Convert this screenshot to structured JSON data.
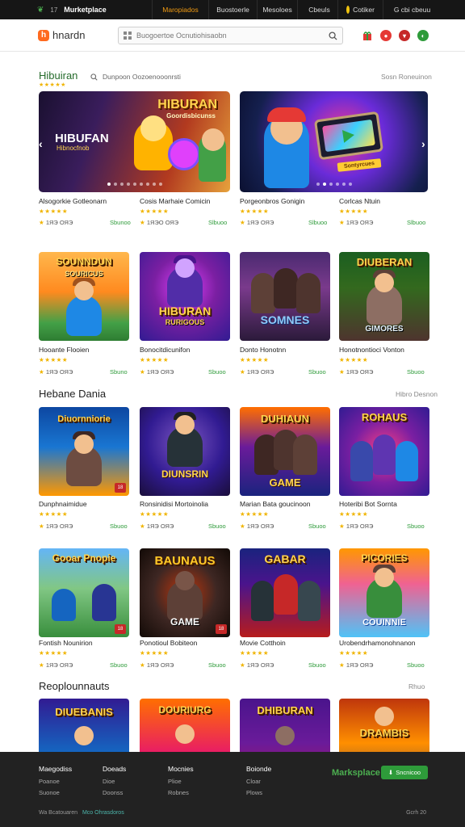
{
  "topbar": {
    "number": "17",
    "brand": "Murketplace",
    "items": [
      {
        "label": "Maropiados",
        "active": true
      },
      {
        "label": "Buostoerle",
        "active": false
      },
      {
        "label": "Mesoloes",
        "active": false
      },
      {
        "label": "Cbeuls",
        "active": false,
        "icon": "coin-icon"
      },
      {
        "label": "Cotiker",
        "active": false,
        "icon": "coin-icon"
      },
      {
        "label": "G cbi cbeuu",
        "active": false,
        "icon": "gift-icon"
      }
    ]
  },
  "header": {
    "logo_letter": "h",
    "logo_text": "hnardn",
    "search_placeholder": "Buogoertoe Ocnutiohisaobn"
  },
  "section1": {
    "title": "Hibuiran",
    "stars": "★★★★★",
    "filter_text": "Dunpoon   Oozoenooonrsti",
    "link": "Sosn Roneuinon"
  },
  "banners": [
    {
      "title": "HIBUFAN",
      "subtitle": "Hibnocfnob",
      "logo": "HIBURAN",
      "logo_sub": "Goordisbicunss"
    },
    {
      "tag": "Sontyrcues"
    }
  ],
  "banner_captions": [
    {
      "name": "Alsogorkie Gotleonarn",
      "rating": "★★★★★",
      "meta": "1ЯЭ  ОЯЭ",
      "price": "Sbunoo"
    },
    {
      "name": "Cosis Marhaie Comicin",
      "rating": "★★★★★",
      "meta": "1ЯЭО ОЯЭ",
      "price": "Slbuoo"
    },
    {
      "name": "Porgeonbros Gonigin",
      "rating": "★★★★★",
      "meta": "1ЯЭ  ОЯЭ",
      "price": "Slbuoo"
    },
    {
      "name": "Corlcas Ntuin",
      "rating": "★★★★★",
      "meta": "1ЯЭ  ОЯЭ",
      "price": "Slbuoo"
    }
  ],
  "row1": [
    {
      "logo": "SOUNNDUN",
      "sub": "SOURICUS",
      "name": "Hooante Flooien",
      "rating": "★★★★★",
      "meta": "1ЯЭ  ОЯЭ",
      "price": "Sbuno"
    },
    {
      "logo": "HIBURAN",
      "sub": "RURIGOUS",
      "name": "Bonocitdicunifon",
      "rating": "★★★★★",
      "meta": "1ЯЭ  ОЯЭ",
      "price": "Sbuoo"
    },
    {
      "logo": "",
      "sub": "SOMNES",
      "name": "Donto Honotnn",
      "rating": "★★★★★",
      "meta": "1ЯЭ  ОЯЭ",
      "price": "Sbuoo"
    },
    {
      "logo": "DIUBERAN",
      "sub": "GIMORES",
      "name": "Honotnontioci Vonton",
      "rating": "★★★★★",
      "meta": "1ЯЭ  ОЯЭ",
      "price": "Sbuoo"
    }
  ],
  "section2": {
    "title": "Hebane Dania",
    "link": "Hibro Desnon"
  },
  "row2": [
    {
      "logo": "Diuornniorie",
      "sub": "",
      "name": "Dunphnaimidue",
      "rating": "★★★★★",
      "meta": "1ЯЭ  ОЯЭ",
      "price": "Sbuoo"
    },
    {
      "logo": "",
      "sub": "DIUNSRIN",
      "name": "Ronsinidisi Mortoinolia",
      "rating": "★★★★★",
      "meta": "1ЯЭ  ОЯЭ",
      "price": "Sbuoo"
    },
    {
      "logo": "DUHIAUN",
      "sub": "GAME",
      "name": "Marian Bata goucinoon",
      "rating": "★★★★★",
      "meta": "1ЯЭ  ОЯЭ",
      "price": "Sbuoo"
    },
    {
      "logo": "ROHAUS",
      "sub": "",
      "name": "Hoteribi Bot Sornta",
      "rating": "★★★★★",
      "meta": "1ЯЭ  ОЯЭ",
      "price": "Sbuoo"
    }
  ],
  "row3": [
    {
      "logo": "Gooar Pnopie",
      "sub": "",
      "name": "Fontish Nounirion",
      "rating": "★★★★★",
      "meta": "1ЯЭ  ОЯЭ",
      "price": "Sbuoo"
    },
    {
      "logo": "BAUNAUS",
      "sub": "GAME",
      "name": "Ponotioul Bobiteon",
      "rating": "★★★★★",
      "meta": "1ЯЭ  ОЯЭ",
      "price": "Sbuoo"
    },
    {
      "logo": "GABAR",
      "sub": "",
      "name": "Movie Cotthoin",
      "rating": "★★★★★",
      "meta": "1ЯЭ  ОЯЭ",
      "price": "Sbuoo"
    },
    {
      "logo": "PICORIES",
      "sub": "COUINNIE",
      "name": "Urobendrhamonohnanon",
      "rating": "★★★★★",
      "meta": "1ЯЭ  ОЯЭ",
      "price": "Sbuoo"
    }
  ],
  "section3": {
    "title": "Reoplounnauts",
    "link": "Rhuo"
  },
  "row4": [
    {
      "logo": "DIUEBANIS"
    },
    {
      "logo": "DOURIURG"
    },
    {
      "logo": "DHIBURAN"
    },
    {
      "logo": "DRAMBIS"
    }
  ],
  "footer": {
    "cols": [
      {
        "head": "Maegodiss",
        "links": [
          "Poanoe",
          "Suonoe"
        ]
      },
      {
        "head": "Doeads",
        "links": [
          "Dioe",
          "Doonss"
        ]
      },
      {
        "head": "Mocnies",
        "links": [
          "Plioe",
          "Robnes"
        ]
      },
      {
        "head": "Boionde",
        "links": [
          "Cloar",
          "Plows"
        ]
      }
    ],
    "brand": "Marksplace",
    "button": "Sncnicoo",
    "copyright": "Wa Bcatouaren",
    "copyright_link": "Mco Ohrasdoros",
    "right_text": "Gcrh   20"
  },
  "colors": {
    "accent": "#2e9b3a",
    "star": "#f0b400",
    "orange": "#f39c12",
    "dark": "#161616"
  }
}
